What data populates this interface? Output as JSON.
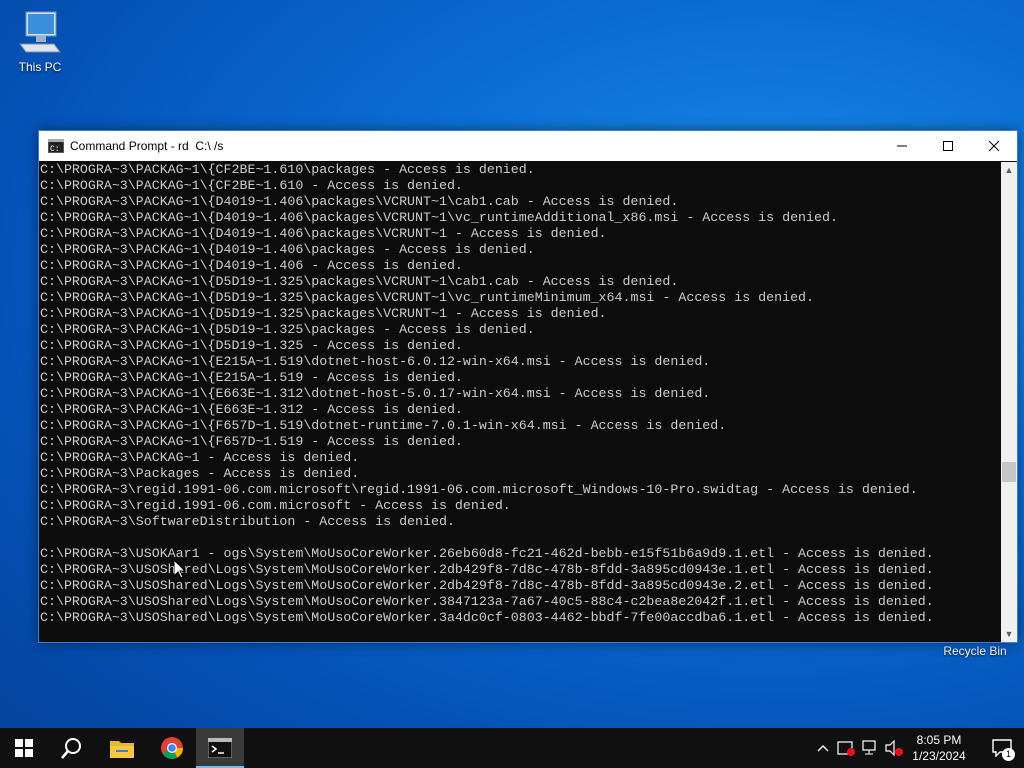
{
  "desktop": {
    "icons": [
      {
        "label": "This PC"
      },
      {
        "label": "Recycle Bin"
      }
    ]
  },
  "window": {
    "title": "Command Prompt - rd  C:\\ /s",
    "console_lines": [
      "C:\\PROGRA~3\\PACKAG~1\\{CF2BE~1.610\\packages - Access is denied.",
      "C:\\PROGRA~3\\PACKAG~1\\{CF2BE~1.610 - Access is denied.",
      "C:\\PROGRA~3\\PACKAG~1\\{D4019~1.406\\packages\\VCRUNT~1\\cab1.cab - Access is denied.",
      "C:\\PROGRA~3\\PACKAG~1\\{D4019~1.406\\packages\\VCRUNT~1\\vc_runtimeAdditional_x86.msi - Access is denied.",
      "C:\\PROGRA~3\\PACKAG~1\\{D4019~1.406\\packages\\VCRUNT~1 - Access is denied.",
      "C:\\PROGRA~3\\PACKAG~1\\{D4019~1.406\\packages - Access is denied.",
      "C:\\PROGRA~3\\PACKAG~1\\{D4019~1.406 - Access is denied.",
      "C:\\PROGRA~3\\PACKAG~1\\{D5D19~1.325\\packages\\VCRUNT~1\\cab1.cab - Access is denied.",
      "C:\\PROGRA~3\\PACKAG~1\\{D5D19~1.325\\packages\\VCRUNT~1\\vc_runtimeMinimum_x64.msi - Access is denied.",
      "C:\\PROGRA~3\\PACKAG~1\\{D5D19~1.325\\packages\\VCRUNT~1 - Access is denied.",
      "C:\\PROGRA~3\\PACKAG~1\\{D5D19~1.325\\packages - Access is denied.",
      "C:\\PROGRA~3\\PACKAG~1\\{D5D19~1.325 - Access is denied.",
      "C:\\PROGRA~3\\PACKAG~1\\{E215A~1.519\\dotnet-host-6.0.12-win-x64.msi - Access is denied.",
      "C:\\PROGRA~3\\PACKAG~1\\{E215A~1.519 - Access is denied.",
      "C:\\PROGRA~3\\PACKAG~1\\{E663E~1.312\\dotnet-host-5.0.17-win-x64.msi - Access is denied.",
      "C:\\PROGRA~3\\PACKAG~1\\{E663E~1.312 - Access is denied.",
      "C:\\PROGRA~3\\PACKAG~1\\{F657D~1.519\\dotnet-runtime-7.0.1-win-x64.msi - Access is denied.",
      "C:\\PROGRA~3\\PACKAG~1\\{F657D~1.519 - Access is denied.",
      "C:\\PROGRA~3\\PACKAG~1 - Access is denied.",
      "C:\\PROGRA~3\\Packages - Access is denied.",
      "C:\\PROGRA~3\\regid.1991-06.com.microsoft\\regid.1991-06.com.microsoft_Windows-10-Pro.swidtag - Access is denied.",
      "C:\\PROGRA~3\\regid.1991-06.com.microsoft - Access is denied.",
      "C:\\PROGRA~3\\SoftwareDistribution - Access is denied.",
      "",
      "C:\\PROGRA~3\\USOKAar1 - ogs\\System\\MoUsoCoreWorker.26eb60d8-fc21-462d-bebb-e15f51b6a9d9.1.etl - Access is denied.",
      "C:\\PROGRA~3\\USOShared\\Logs\\System\\MoUsoCoreWorker.2db429f8-7d8c-478b-8fdd-3a895cd0943e.1.etl - Access is denied.",
      "C:\\PROGRA~3\\USOShared\\Logs\\System\\MoUsoCoreWorker.2db429f8-7d8c-478b-8fdd-3a895cd0943e.2.etl - Access is denied.",
      "C:\\PROGRA~3\\USOShared\\Logs\\System\\MoUsoCoreWorker.3847123a-7a67-40c5-88c4-c2bea8e2042f.1.etl - Access is denied.",
      "C:\\PROGRA~3\\USOShared\\Logs\\System\\MoUsoCoreWorker.3a4dc0cf-0803-4462-bbdf-7fe00accdba6.1.etl - Access is denied."
    ]
  },
  "taskbar": {
    "clock_time": "8:05 PM",
    "clock_date": "1/23/2024",
    "notification_count": "1"
  }
}
